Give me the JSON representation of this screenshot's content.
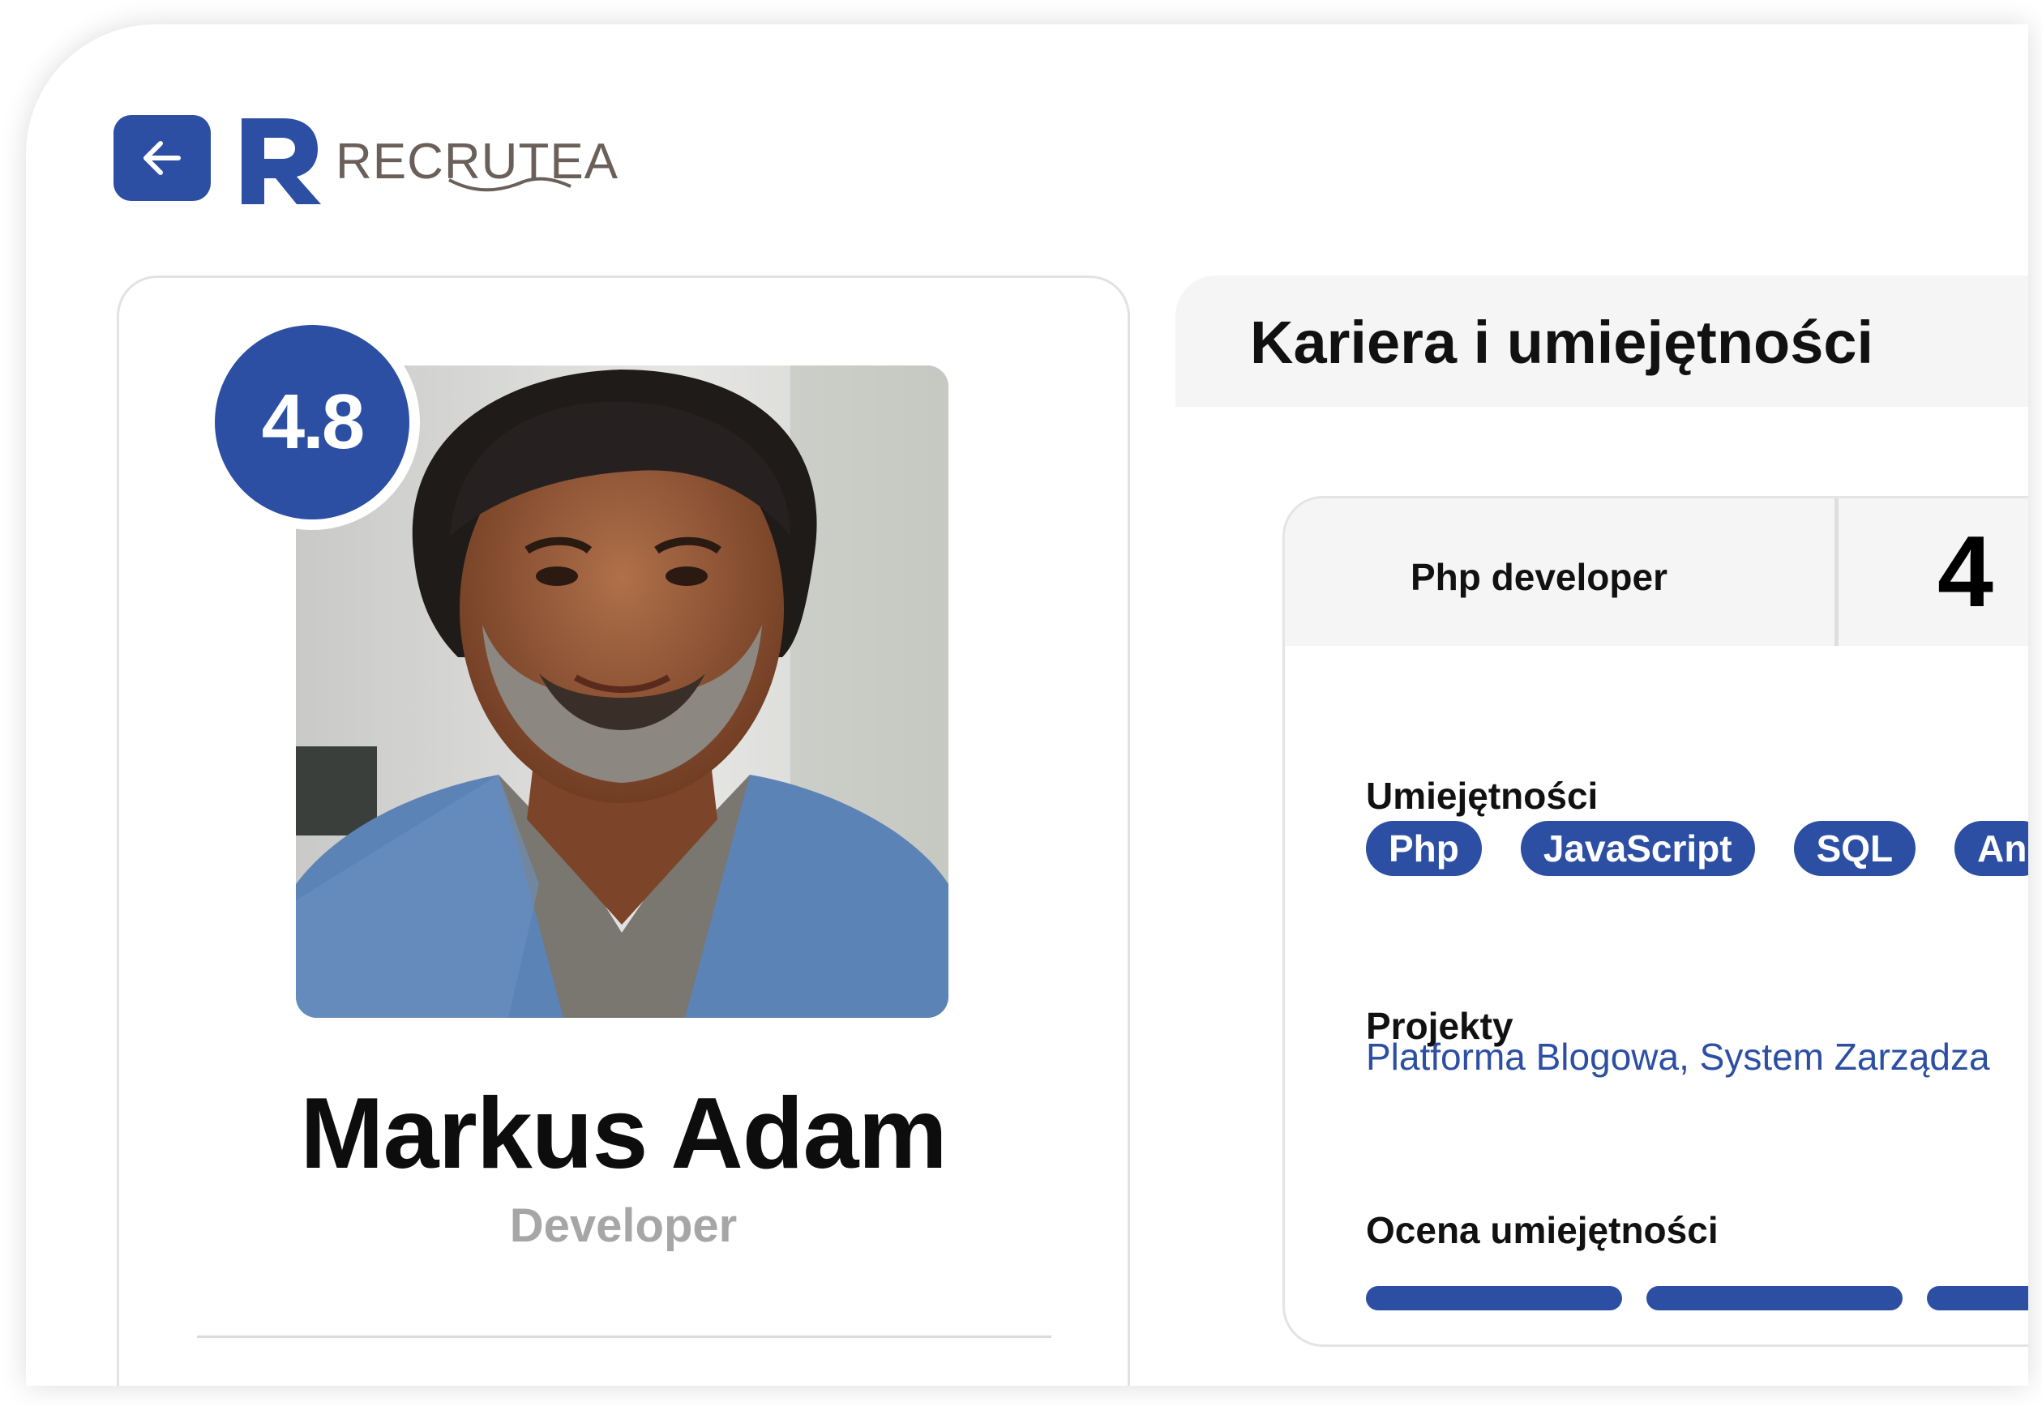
{
  "brand": {
    "name": "RECRUTEA",
    "mark": "R",
    "accent": "#2c4fa3"
  },
  "header": {
    "back_icon": "arrow-left-icon"
  },
  "profile": {
    "rating": "4.8",
    "name": "Markus Adam",
    "role": "Developer"
  },
  "career": {
    "title": "Kariera i umiejętności",
    "position": "Php developer",
    "years": "4",
    "skills_label": "Umiejętności",
    "skills": [
      "Php",
      "JavaScript",
      "SQL",
      "An"
    ],
    "projects_label": "Projekty",
    "projects": "Platforma Blogowa, System Zarządza",
    "assessment_label": "Ocena umiejętności"
  }
}
